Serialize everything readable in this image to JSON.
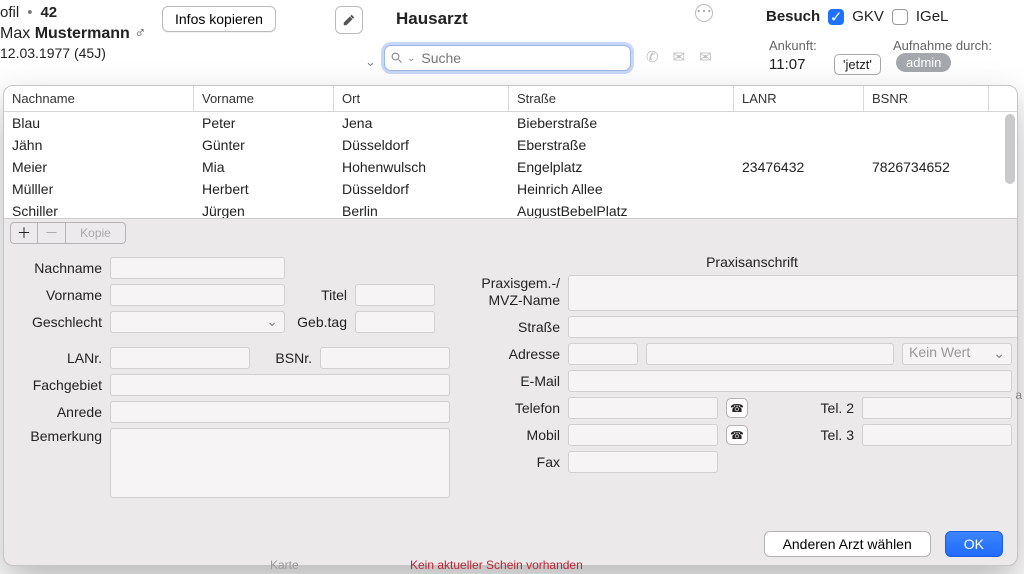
{
  "profile": {
    "prefix": "ofil",
    "id": "42",
    "first": "Max",
    "last": "Mustermann",
    "gender_glyph": "♂",
    "dob_line": "12.03.1977 (45J)",
    "copy_btn": "Infos kopieren"
  },
  "hausarzt_label": "Hausarzt",
  "search": {
    "placeholder": "Suche",
    "value": ""
  },
  "besuch": {
    "label": "Besuch",
    "gkv": "GKV",
    "igel": "IGeL",
    "gkv_checked": true,
    "igel_checked": false,
    "ankunft_label": "Ankunft:",
    "ankunft_value": "11:07",
    "jetzt": "'jetzt'",
    "aufnahme_label": "Aufnahme durch:",
    "admin": "admin"
  },
  "table": {
    "headers": {
      "nachname": "Nachname",
      "vorname": "Vorname",
      "ort": "Ort",
      "strasse": "Straße",
      "lanr": "LANR",
      "bsnr": "BSNR"
    },
    "rows": [
      {
        "na": "Blau",
        "vo": "Peter",
        "or": "Jena",
        "st": "Bieberstraße",
        "la": "",
        "bs": ""
      },
      {
        "na": "Jähn",
        "vo": "Günter",
        "or": "Düsseldorf",
        "st": "Eberstraße",
        "la": "",
        "bs": ""
      },
      {
        "na": "Meier",
        "vo": "Mia",
        "or": "Hohenwulsch",
        "st": "Engelplatz",
        "la": "23476432",
        "bs": "7826734652"
      },
      {
        "na": "Mülller",
        "vo": "Herbert",
        "or": "Düsseldorf",
        "st": "Heinrich Allee",
        "la": "",
        "bs": ""
      },
      {
        "na": "Schiller",
        "vo": "Jürgen",
        "or": "Berlin",
        "st": "AugustBebelPlatz",
        "la": "",
        "bs": ""
      }
    ]
  },
  "mini_tb": {
    "kopie": "Kopie"
  },
  "form_left": {
    "nachname": "Nachname",
    "vorname": "Vorname",
    "geschlecht": "Geschlecht",
    "titel": "Titel",
    "gebtag": "Geb.tag",
    "lanr": "LANr.",
    "bsnr": "BSNr.",
    "fachgebiet": "Fachgebiet",
    "anrede": "Anrede",
    "bemerkung": "Bemerkung"
  },
  "form_right": {
    "title": "Praxisanschrift",
    "praxisgem": "Praxisgem.-/\nMVZ-Name",
    "praxisgem_l1": "Praxisgem.-/",
    "praxisgem_l2": "MVZ-Name",
    "strasse": "Straße",
    "adresse": "Adresse",
    "kein_wert": "Kein Wert",
    "email": "E-Mail",
    "telefon": "Telefon",
    "tel2": "Tel. 2",
    "mobil": "Mobil",
    "tel3": "Tel. 3",
    "fax": "Fax"
  },
  "footer": {
    "other": "Anderen Arzt wählen",
    "ok": "OK"
  },
  "bg": {
    "karte": "Karte",
    "schein": "Kein aktueller Schein vorhanden",
    "a": "a"
  }
}
